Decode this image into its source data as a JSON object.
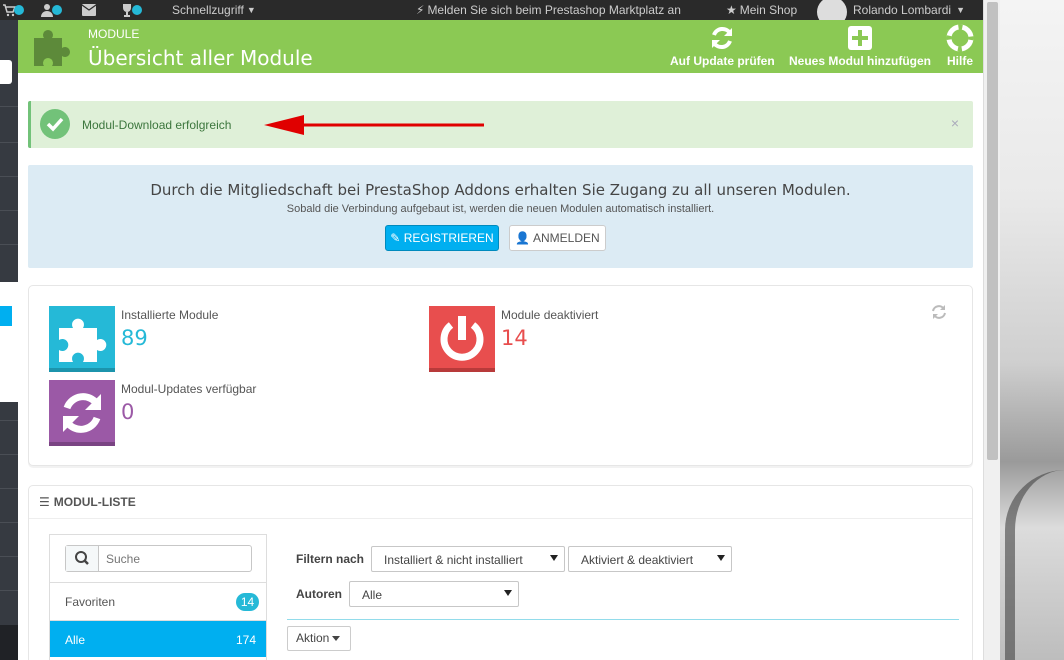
{
  "topbar": {
    "quick_access": "Schnellzugriff",
    "marketplace": "Melden Sie sich beim Prestashop Marktplatz an",
    "shop": "Mein Shop",
    "user": "Rolando Lombardi"
  },
  "header": {
    "breadcrumb": "MODULE",
    "title": "Übersicht aller Module",
    "buttons": {
      "check_update": "Auf Update prüfen",
      "add_module": "Neues Modul hinzufügen",
      "help": "Hilfe"
    }
  },
  "alert_success": {
    "message": "Modul-Download erfolgreich",
    "close": "×"
  },
  "addons_info": {
    "headline": "Durch die Mitgliedschaft bei PrestaShop Addons erhalten Sie Zugang zu all unseren Modulen.",
    "subline": "Sobald die Verbindung aufgebaut ist, werden die neuen Modulen automatisch installiert.",
    "register_label": "REGISTRIEREN",
    "login_label": "ANMELDEN"
  },
  "stats": {
    "installed": {
      "label": "Installierte Module",
      "value": "89"
    },
    "disabled": {
      "label": "Module deaktiviert",
      "value": "14"
    },
    "updates": {
      "label": "Modul-Updates verfügbar",
      "value": "0"
    }
  },
  "module_list": {
    "heading": "MODUL-LISTE",
    "search_placeholder": "Suche",
    "categories": [
      {
        "label": "Favoriten",
        "count": "14"
      },
      {
        "label": "Alle",
        "count": "174"
      }
    ],
    "filter_label": "Filtern nach",
    "filter_install": "Installiert & nicht installiert",
    "filter_status": "Aktiviert & deaktiviert",
    "authors_label": "Autoren",
    "authors_value": "Alle",
    "action_label": "Aktion"
  },
  "colors": {
    "header_green": "#8bc954",
    "accent_blue": "#00aff0",
    "success_green": "#72c279",
    "danger_red": "#e84e4e",
    "purple": "#9b59a6",
    "arrow_red": "#e00000"
  }
}
